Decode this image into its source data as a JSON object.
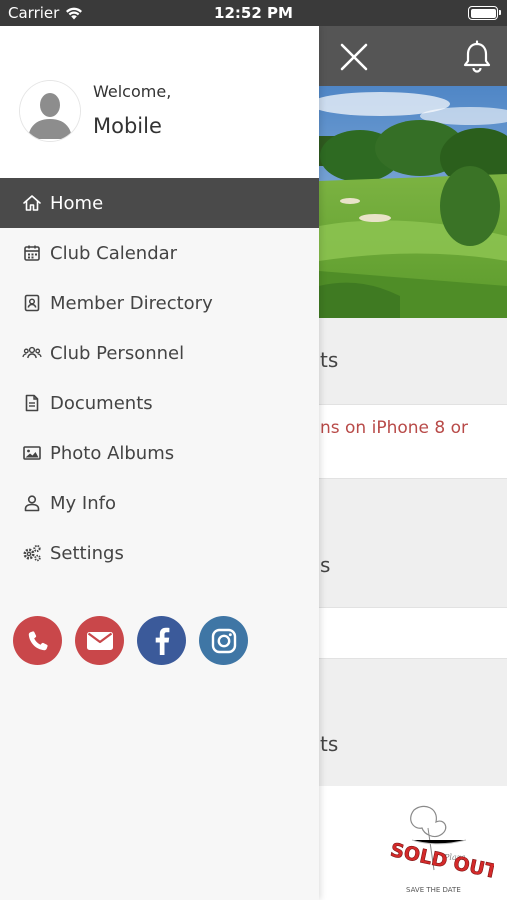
{
  "status_bar": {
    "carrier": "Carrier",
    "time": "12:52 PM"
  },
  "background": {
    "section1_text": "ts",
    "link_text": "ns on iPhone 8 or",
    "section2_text": "s",
    "section3_text": "ts",
    "promo_image": "sold-out-save-the-date"
  },
  "drawer": {
    "profile": {
      "welcome": "Welcome,",
      "name": "Mobile"
    },
    "menu": [
      {
        "label": "Home",
        "icon": "home-icon",
        "active": true
      },
      {
        "label": "Club Calendar",
        "icon": "calendar-icon",
        "active": false
      },
      {
        "label": "Member Directory",
        "icon": "contact-card-icon",
        "active": false
      },
      {
        "label": "Club Personnel",
        "icon": "group-icon",
        "active": false
      },
      {
        "label": "Documents",
        "icon": "document-icon",
        "active": false
      },
      {
        "label": "Photo Albums",
        "icon": "image-icon",
        "active": false
      },
      {
        "label": "My Info",
        "icon": "user-icon",
        "active": false
      },
      {
        "label": "Settings",
        "icon": "gears-icon",
        "active": false
      }
    ],
    "social": [
      {
        "icon": "phone-icon",
        "color": "#c9474a"
      },
      {
        "icon": "email-icon",
        "color": "#c9474a"
      },
      {
        "icon": "facebook-icon",
        "color": "#3b5a9a"
      },
      {
        "icon": "instagram-icon",
        "color": "#3f76a5"
      }
    ]
  },
  "colors": {
    "header": "#555555",
    "active_item": "#4a4a4a",
    "link": "#b84a48"
  }
}
